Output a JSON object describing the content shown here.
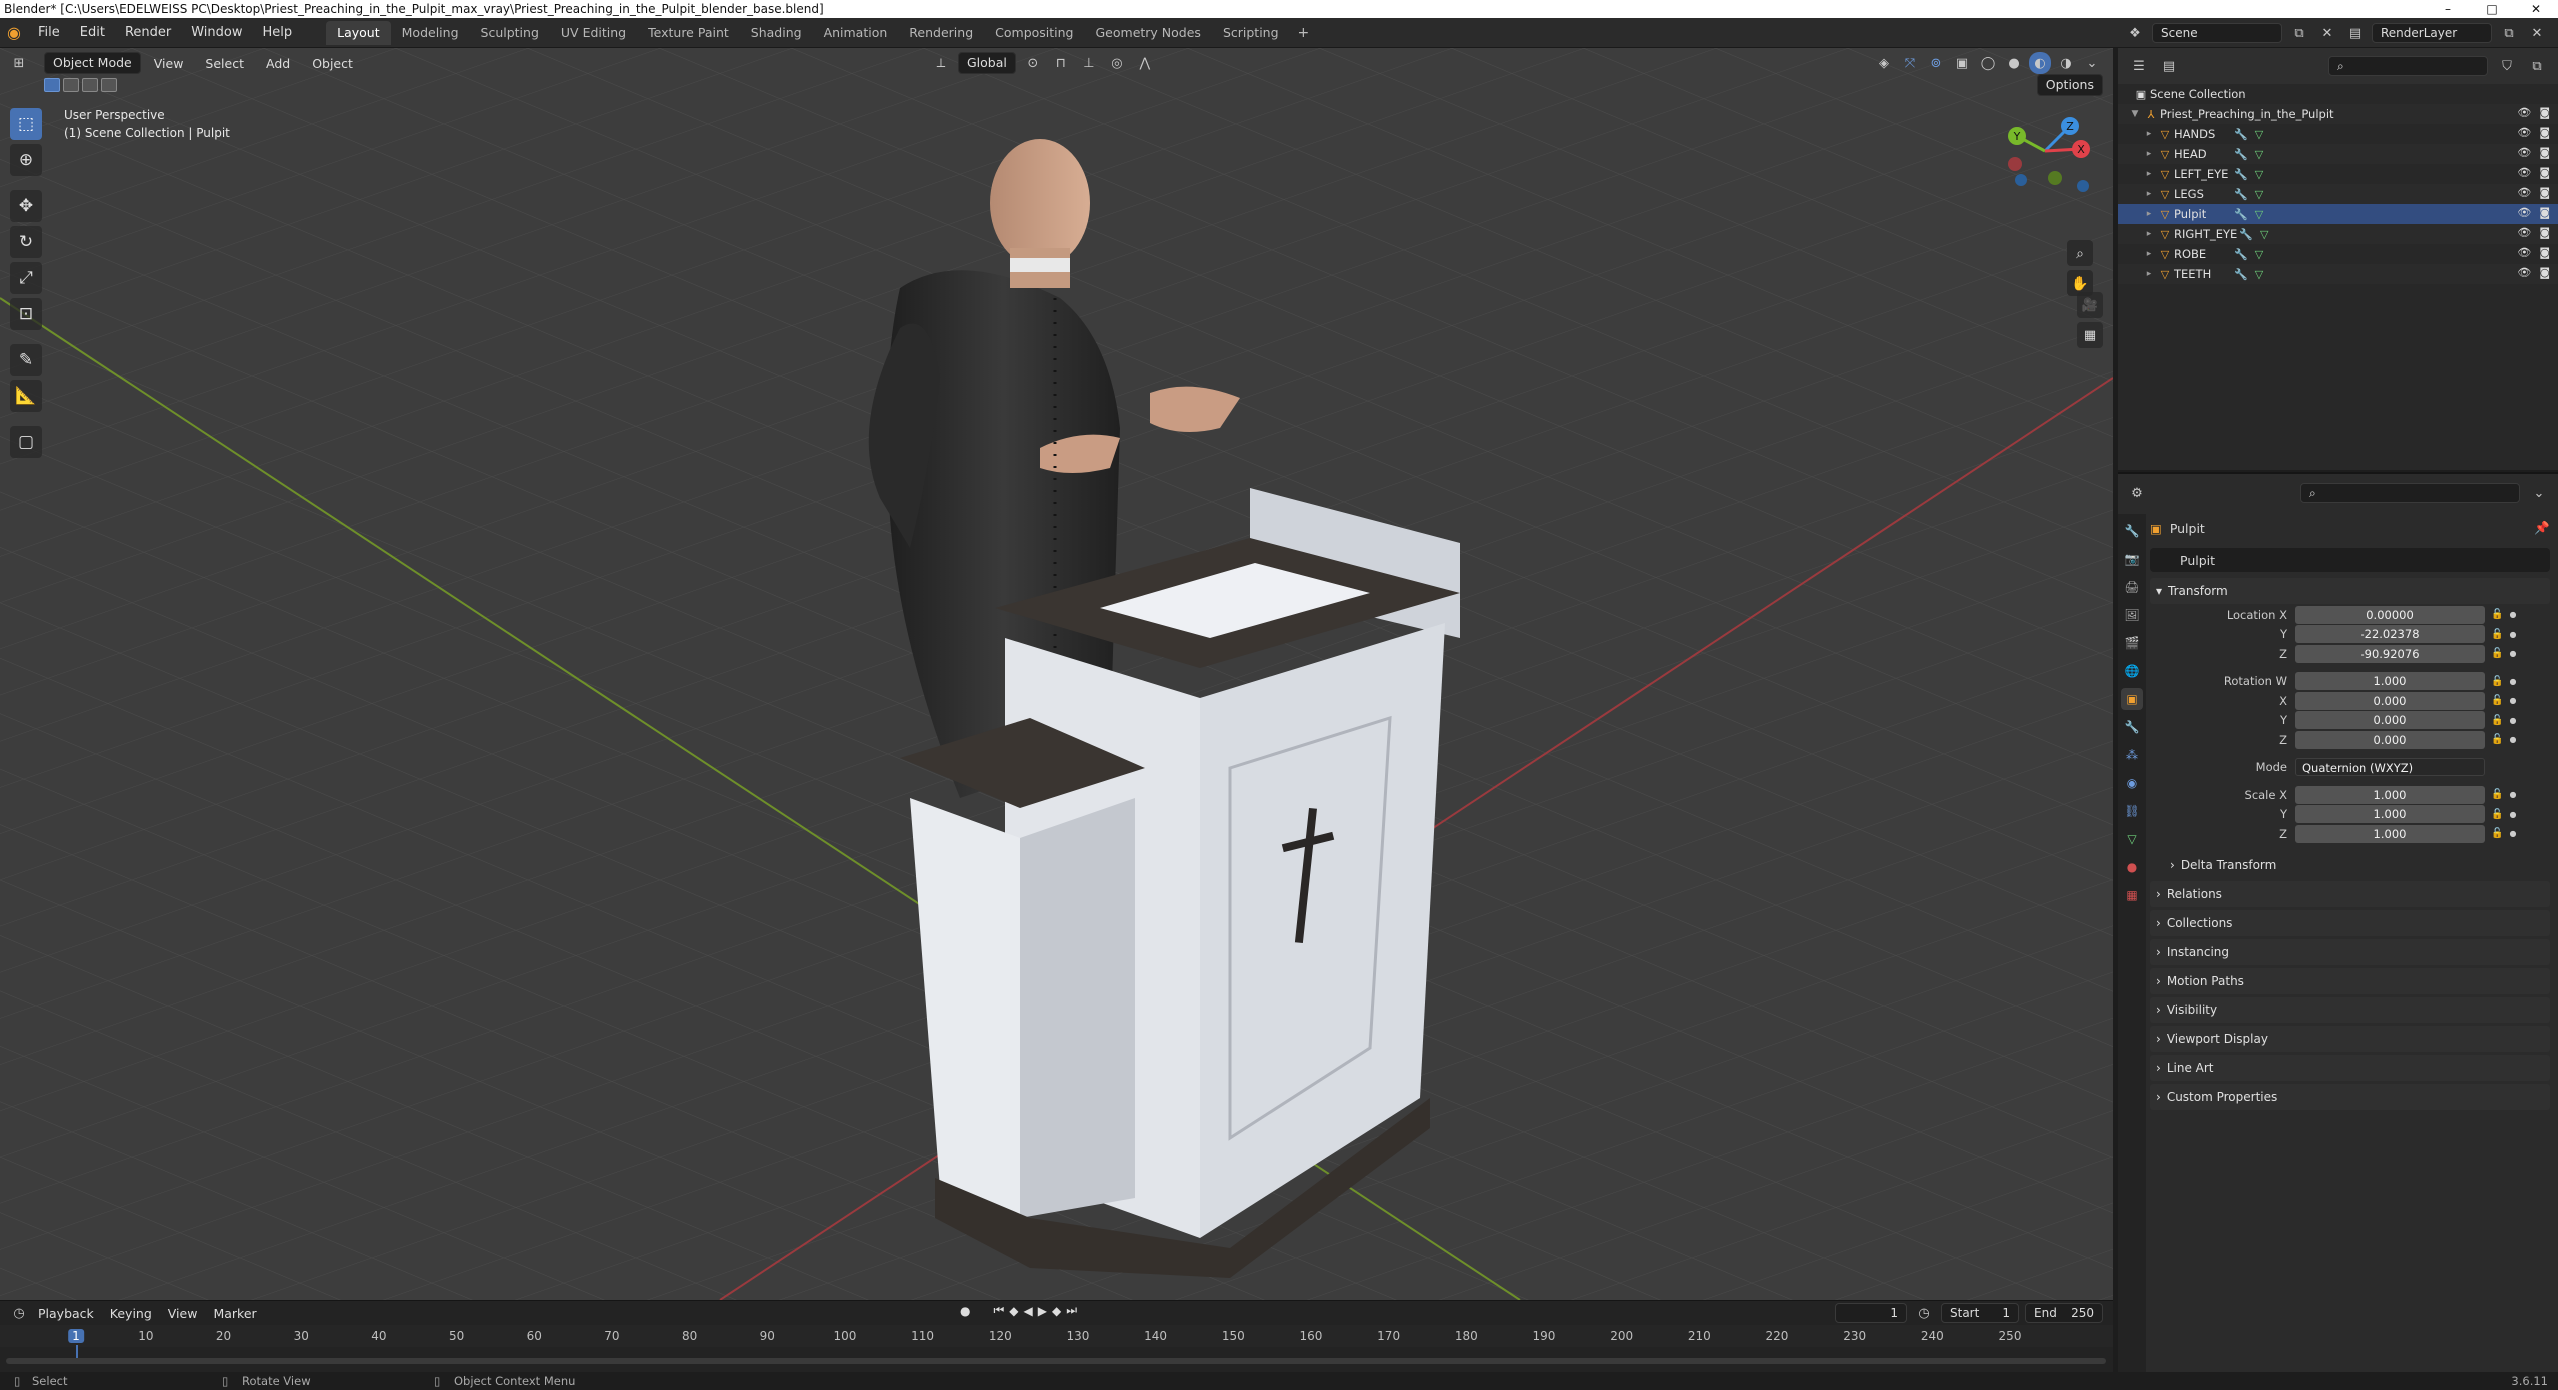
{
  "window": {
    "title": "Blender* [C:\\Users\\EDELWEISS PC\\Desktop\\Priest_Preaching_in_the_Pulpit_max_vray\\Priest_Preaching_in_the_Pulpit_blender_base.blend]",
    "min": "–",
    "max": "□",
    "close": "✕"
  },
  "menus": [
    "File",
    "Edit",
    "Render",
    "Window",
    "Help"
  ],
  "workspaces": [
    "Layout",
    "Modeling",
    "Sculpting",
    "UV Editing",
    "Texture Paint",
    "Shading",
    "Animation",
    "Rendering",
    "Compositing",
    "Geometry Nodes",
    "Scripting"
  ],
  "workspace_add": "+",
  "scene": {
    "name": "Scene",
    "render_layer": "RenderLayer"
  },
  "viewport": {
    "mode": "Object Mode",
    "menus": [
      "View",
      "Select",
      "Add",
      "Object"
    ],
    "transform_orientation": "Global",
    "options_label": "Options",
    "perspective": "User Perspective",
    "collection_info": "(1) Scene Collection | Pulpit",
    "gizmo": {
      "x": "X",
      "y": "Y",
      "z": "Z"
    }
  },
  "outliner": {
    "root": "Scene Collection",
    "collection": "Priest_Preaching_in_the_Pulpit",
    "objects": [
      "HANDS",
      "HEAD",
      "LEFT_EYE",
      "LEGS",
      "Pulpit",
      "RIGHT_EYE",
      "ROBE",
      "TEETH"
    ],
    "selected": "Pulpit"
  },
  "properties": {
    "object_name": "Pulpit",
    "data_name": "Pulpit",
    "transform_label": "Transform",
    "location": {
      "label": "Location X",
      "x": "0.00000",
      "y": "-22.02378",
      "z": "-90.92076"
    },
    "rotation": {
      "label": "Rotation W",
      "w": "1.000",
      "x": "0.000",
      "y": "0.000",
      "z": "0.000"
    },
    "axis_labels": {
      "x": "X",
      "y": "Y",
      "z": "Z"
    },
    "mode": {
      "label": "Mode",
      "value": "Quaternion (WXYZ)"
    },
    "scale": {
      "label": "Scale X",
      "x": "1.000",
      "y": "1.000",
      "z": "1.000"
    },
    "delta": "Delta Transform",
    "panels": [
      "Relations",
      "Collections",
      "Instancing",
      "Motion Paths",
      "Visibility",
      "Viewport Display",
      "Line Art",
      "Custom Properties"
    ]
  },
  "timeline": {
    "menus": [
      "Playback",
      "Keying",
      "View",
      "Marker"
    ],
    "current_frame": "1",
    "start_label": "Start",
    "start": "1",
    "end_label": "End",
    "end": "250",
    "ticks": [
      "1",
      "10",
      "20",
      "30",
      "40",
      "50",
      "60",
      "70",
      "80",
      "90",
      "100",
      "110",
      "120",
      "130",
      "140",
      "150",
      "160",
      "170",
      "180",
      "190",
      "200",
      "210",
      "220",
      "230",
      "240",
      "250"
    ]
  },
  "status": {
    "select": "Select",
    "rotate": "Rotate View",
    "context": "Object Context Menu",
    "version": "3.6.11"
  },
  "colors": {
    "accent": "#4772b3",
    "object_orange": "#f0a030",
    "x_axis": "#e0424a",
    "y_axis": "#78b92a",
    "z_axis": "#3b8fe0"
  }
}
